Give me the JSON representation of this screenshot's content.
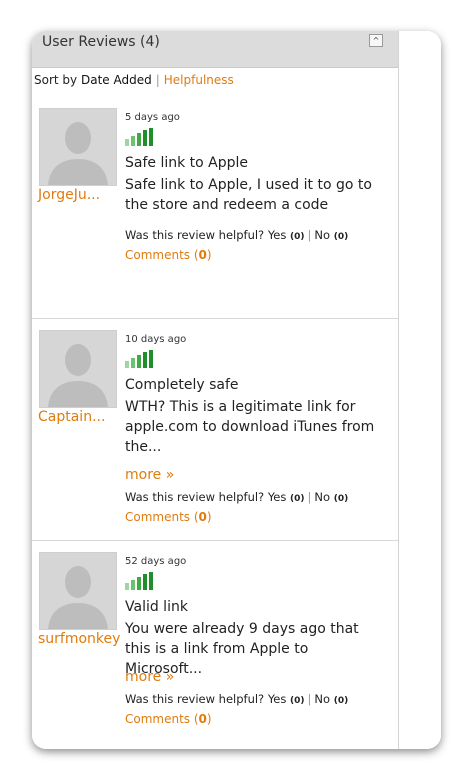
{
  "header": {
    "title": "User Reviews (4)",
    "collapse_icon": "^"
  },
  "sort": {
    "prefix": "Sort by",
    "active": "Date Added",
    "separator": "|",
    "option": "Helpfulness"
  },
  "helpful_prompt": "Was this review helpful?",
  "yes_label": "Yes",
  "no_label": "No",
  "comments_label": "Comments",
  "rating_colors": [
    "#9fd6a0",
    "#6ac46e",
    "#3daa44",
    "#1e8f2a"
  ],
  "reviews": [
    {
      "author": "JorgeJu...",
      "date": "5 days ago",
      "rating": 4,
      "title": "Safe link to Apple",
      "body": "Safe link to Apple, I used it to go to the store and redeem a code",
      "more": "",
      "yes": "(0)",
      "no": "(0)",
      "comments": "0"
    },
    {
      "author": "Captain...",
      "date": "10 days ago",
      "rating": 4,
      "title": "Completely safe",
      "body": "WTH? This is a legitimate link for apple.com to download iTunes from the...",
      "more": "more »",
      "yes": "(0)",
      "no": "(0)",
      "comments": "0"
    },
    {
      "author": "surfmonkey",
      "date": "52 days ago",
      "rating": 4,
      "title": "Valid link",
      "body": "You were already 9 days ago that this is a link from Apple to Microsoft...",
      "more": "more »",
      "yes": "(0)",
      "no": "(0)",
      "comments": "0"
    }
  ]
}
